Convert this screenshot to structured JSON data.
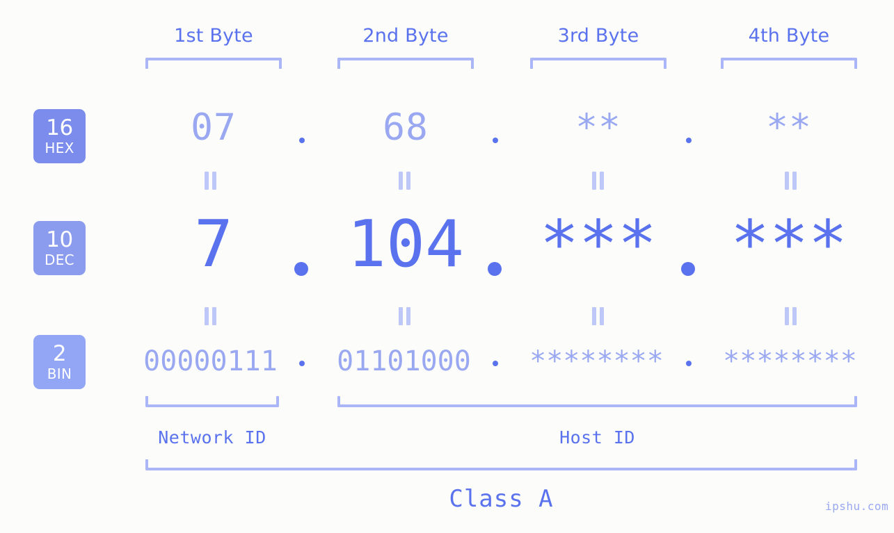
{
  "meta": {
    "watermark": "ipshu.com",
    "background_color": "#fcfdfa",
    "accent_color": "#5a72ee",
    "accent_light_color": "#9aa8f2",
    "bracket_color": "#aab6f7"
  },
  "byte_headers": [
    {
      "label": "1st Byte"
    },
    {
      "label": "2nd Byte"
    },
    {
      "label": "3rd Byte"
    },
    {
      "label": "4th Byte"
    }
  ],
  "rows": [
    {
      "key": "hex",
      "badge": {
        "number": "16",
        "name": "HEX",
        "color": "#7b8cec"
      },
      "values": [
        "07",
        "68",
        "**",
        "**"
      ],
      "separators": [
        ".",
        ".",
        "."
      ]
    },
    {
      "key": "dec",
      "badge": {
        "number": "10",
        "name": "DEC",
        "color": "#8b9bee"
      },
      "values": [
        "7",
        "104",
        "***",
        "***"
      ],
      "separators": [
        ".",
        ".",
        "."
      ]
    },
    {
      "key": "bin",
      "badge": {
        "number": "2",
        "name": "BIN",
        "color": "#93a5f5"
      },
      "values": [
        "00000111",
        "01101000",
        "********",
        "********"
      ],
      "separators": [
        ".",
        ".",
        "."
      ]
    }
  ],
  "equal_marks": {
    "symbol": "=",
    "count_per_gap": 4,
    "gaps": 2
  },
  "segments": [
    {
      "id": "network",
      "label": "Network ID"
    },
    {
      "id": "host",
      "label": "Host ID"
    }
  ],
  "class": {
    "label": "Class A"
  }
}
